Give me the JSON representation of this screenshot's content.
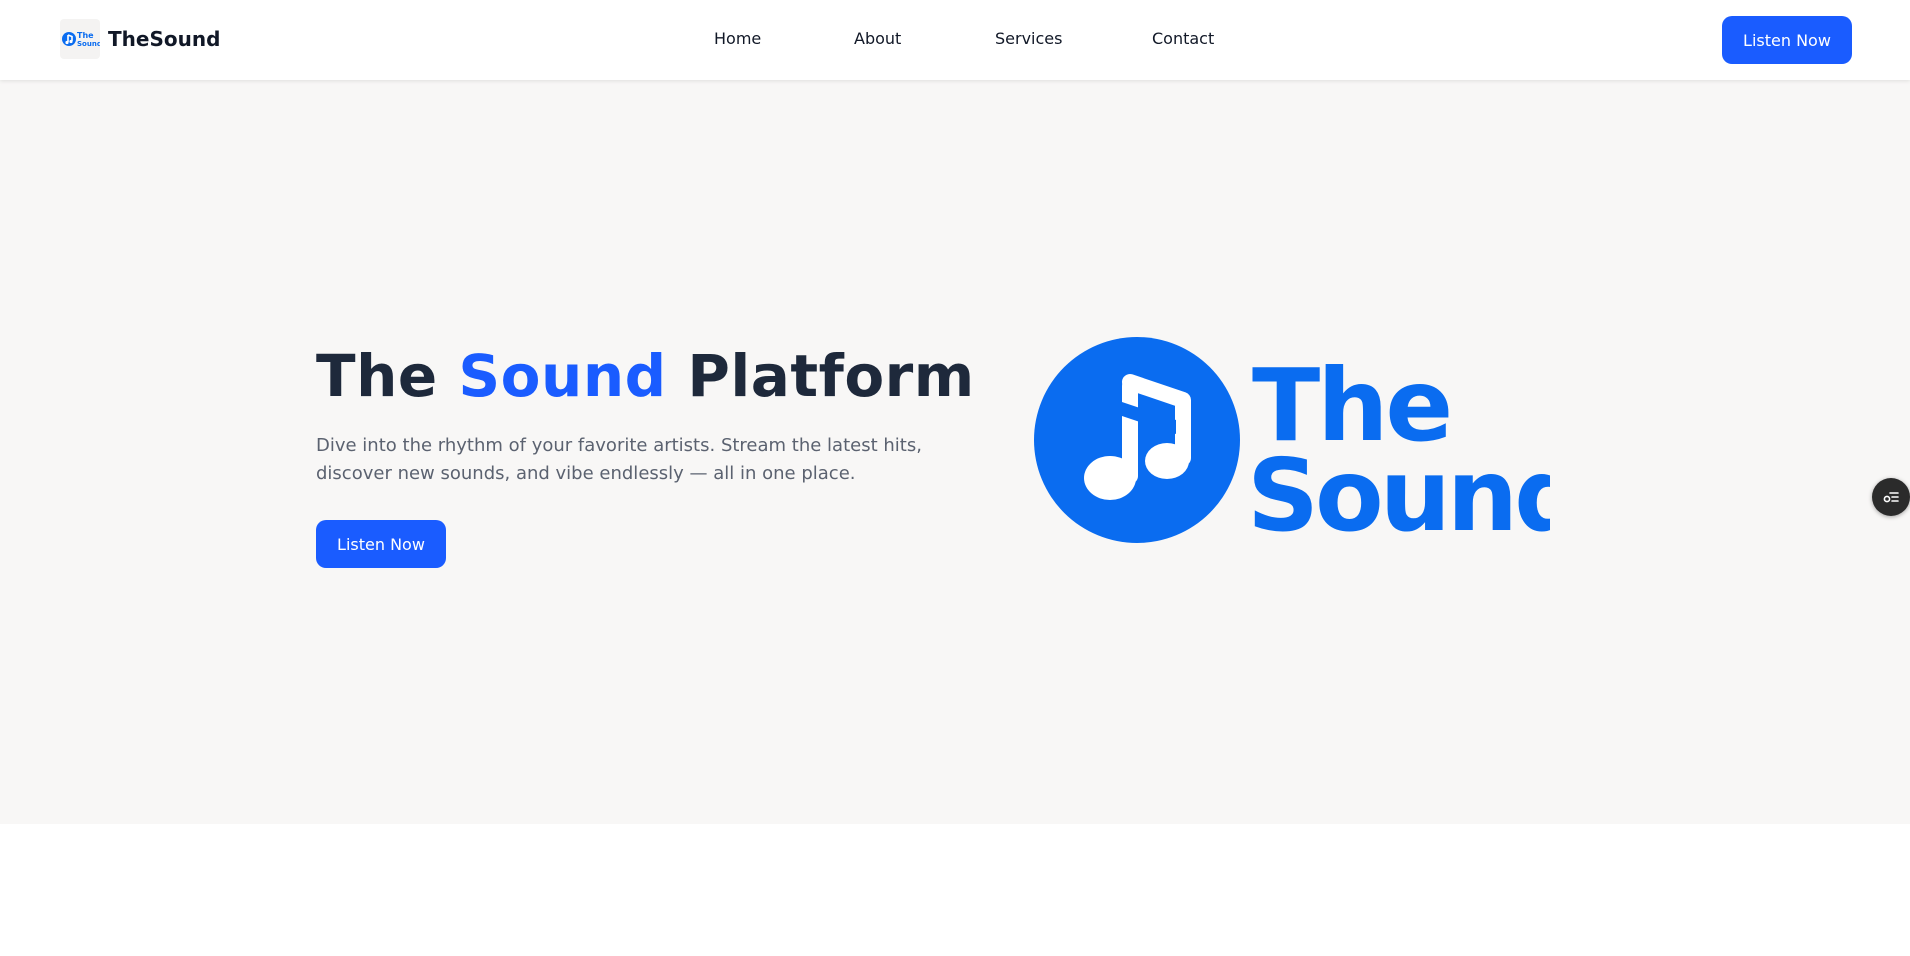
{
  "brand": {
    "name": "TheSound",
    "logo_text_line1": "The",
    "logo_text_line2": "Sound",
    "logo_icon": "music-note-icon"
  },
  "nav": {
    "links": [
      "Home",
      "About",
      "Services",
      "Contact"
    ],
    "cta_label": "Listen Now"
  },
  "hero": {
    "title_part1": "The",
    "title_accent": "Sound",
    "title_part2": "Platform",
    "subtitle": "Dive into the rhythm of your favorite artists. Stream the latest hits, discover new sounds, and vibe endlessly — all in one place.",
    "cta_label": "Listen Now",
    "logo_line1": "The",
    "logo_line2": "Sound"
  },
  "floating_button": {
    "icon": "list-settings-icon"
  },
  "colors": {
    "accent": "#1a5cff",
    "logo_blue": "#0a6cf0",
    "heading": "#1e293b",
    "hero_bg": "#f8f7f6"
  }
}
